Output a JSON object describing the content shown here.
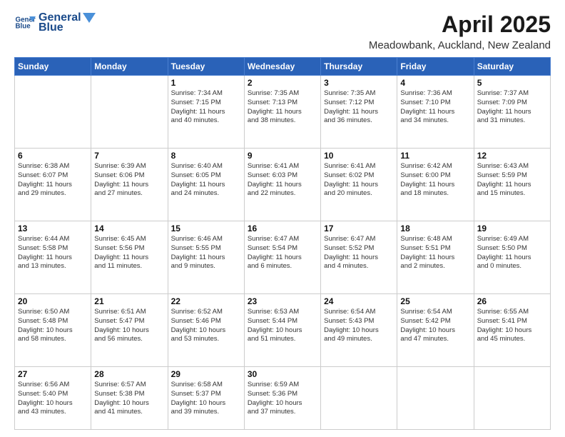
{
  "header": {
    "logo_line1": "General",
    "logo_line2": "Blue",
    "title": "April 2025",
    "subtitle": "Meadowbank, Auckland, New Zealand"
  },
  "weekdays": [
    "Sunday",
    "Monday",
    "Tuesday",
    "Wednesday",
    "Thursday",
    "Friday",
    "Saturday"
  ],
  "weeks": [
    [
      {
        "day": "",
        "info": ""
      },
      {
        "day": "",
        "info": ""
      },
      {
        "day": "1",
        "info": "Sunrise: 7:34 AM\nSunset: 7:15 PM\nDaylight: 11 hours\nand 40 minutes."
      },
      {
        "day": "2",
        "info": "Sunrise: 7:35 AM\nSunset: 7:13 PM\nDaylight: 11 hours\nand 38 minutes."
      },
      {
        "day": "3",
        "info": "Sunrise: 7:35 AM\nSunset: 7:12 PM\nDaylight: 11 hours\nand 36 minutes."
      },
      {
        "day": "4",
        "info": "Sunrise: 7:36 AM\nSunset: 7:10 PM\nDaylight: 11 hours\nand 34 minutes."
      },
      {
        "day": "5",
        "info": "Sunrise: 7:37 AM\nSunset: 7:09 PM\nDaylight: 11 hours\nand 31 minutes."
      }
    ],
    [
      {
        "day": "6",
        "info": "Sunrise: 6:38 AM\nSunset: 6:07 PM\nDaylight: 11 hours\nand 29 minutes."
      },
      {
        "day": "7",
        "info": "Sunrise: 6:39 AM\nSunset: 6:06 PM\nDaylight: 11 hours\nand 27 minutes."
      },
      {
        "day": "8",
        "info": "Sunrise: 6:40 AM\nSunset: 6:05 PM\nDaylight: 11 hours\nand 24 minutes."
      },
      {
        "day": "9",
        "info": "Sunrise: 6:41 AM\nSunset: 6:03 PM\nDaylight: 11 hours\nand 22 minutes."
      },
      {
        "day": "10",
        "info": "Sunrise: 6:41 AM\nSunset: 6:02 PM\nDaylight: 11 hours\nand 20 minutes."
      },
      {
        "day": "11",
        "info": "Sunrise: 6:42 AM\nSunset: 6:00 PM\nDaylight: 11 hours\nand 18 minutes."
      },
      {
        "day": "12",
        "info": "Sunrise: 6:43 AM\nSunset: 5:59 PM\nDaylight: 11 hours\nand 15 minutes."
      }
    ],
    [
      {
        "day": "13",
        "info": "Sunrise: 6:44 AM\nSunset: 5:58 PM\nDaylight: 11 hours\nand 13 minutes."
      },
      {
        "day": "14",
        "info": "Sunrise: 6:45 AM\nSunset: 5:56 PM\nDaylight: 11 hours\nand 11 minutes."
      },
      {
        "day": "15",
        "info": "Sunrise: 6:46 AM\nSunset: 5:55 PM\nDaylight: 11 hours\nand 9 minutes."
      },
      {
        "day": "16",
        "info": "Sunrise: 6:47 AM\nSunset: 5:54 PM\nDaylight: 11 hours\nand 6 minutes."
      },
      {
        "day": "17",
        "info": "Sunrise: 6:47 AM\nSunset: 5:52 PM\nDaylight: 11 hours\nand 4 minutes."
      },
      {
        "day": "18",
        "info": "Sunrise: 6:48 AM\nSunset: 5:51 PM\nDaylight: 11 hours\nand 2 minutes."
      },
      {
        "day": "19",
        "info": "Sunrise: 6:49 AM\nSunset: 5:50 PM\nDaylight: 11 hours\nand 0 minutes."
      }
    ],
    [
      {
        "day": "20",
        "info": "Sunrise: 6:50 AM\nSunset: 5:48 PM\nDaylight: 10 hours\nand 58 minutes."
      },
      {
        "day": "21",
        "info": "Sunrise: 6:51 AM\nSunset: 5:47 PM\nDaylight: 10 hours\nand 56 minutes."
      },
      {
        "day": "22",
        "info": "Sunrise: 6:52 AM\nSunset: 5:46 PM\nDaylight: 10 hours\nand 53 minutes."
      },
      {
        "day": "23",
        "info": "Sunrise: 6:53 AM\nSunset: 5:44 PM\nDaylight: 10 hours\nand 51 minutes."
      },
      {
        "day": "24",
        "info": "Sunrise: 6:54 AM\nSunset: 5:43 PM\nDaylight: 10 hours\nand 49 minutes."
      },
      {
        "day": "25",
        "info": "Sunrise: 6:54 AM\nSunset: 5:42 PM\nDaylight: 10 hours\nand 47 minutes."
      },
      {
        "day": "26",
        "info": "Sunrise: 6:55 AM\nSunset: 5:41 PM\nDaylight: 10 hours\nand 45 minutes."
      }
    ],
    [
      {
        "day": "27",
        "info": "Sunrise: 6:56 AM\nSunset: 5:40 PM\nDaylight: 10 hours\nand 43 minutes."
      },
      {
        "day": "28",
        "info": "Sunrise: 6:57 AM\nSunset: 5:38 PM\nDaylight: 10 hours\nand 41 minutes."
      },
      {
        "day": "29",
        "info": "Sunrise: 6:58 AM\nSunset: 5:37 PM\nDaylight: 10 hours\nand 39 minutes."
      },
      {
        "day": "30",
        "info": "Sunrise: 6:59 AM\nSunset: 5:36 PM\nDaylight: 10 hours\nand 37 minutes."
      },
      {
        "day": "",
        "info": ""
      },
      {
        "day": "",
        "info": ""
      },
      {
        "day": "",
        "info": ""
      }
    ]
  ]
}
